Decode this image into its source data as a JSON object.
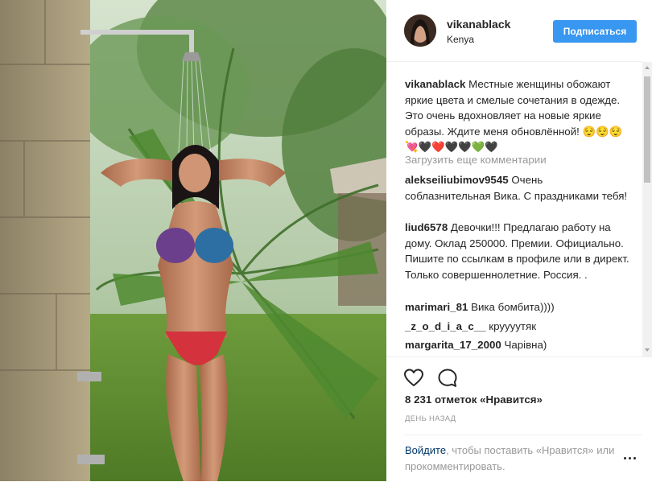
{
  "header": {
    "username": "vikanablack",
    "location": "Kenya",
    "follow_label": "Подписаться"
  },
  "caption": {
    "username": "vikanablack",
    "text": "Местные женщины обожают яркие цвета и смелые сочетания в одежде. Это очень вдохновляет на новые яркие образы. Ждите меня обновлённой!",
    "emoji": "😌😌😌💘🖤❤️🖤🖤💚🖤"
  },
  "load_more_label": "Загрузить еще комментарии",
  "comments": [
    {
      "username": "alekseiliubimov9545",
      "text": "Очень соблазнительная Вика. С праздниками тебя!"
    },
    {
      "username": "liud6578",
      "text": "Девочки!!! Предлагаю работу на дому. Оклад 250000. Премии. Официально. Пишите по ссылкам в профиле или в директ. Только совершеннолетние. Россия. ."
    },
    {
      "username": "marimari_81",
      "text": "Вика бомбита))))"
    },
    {
      "username": "_z_o_d_i_a_c__",
      "text": "круууутяк"
    },
    {
      "username": "margarita_17_2000",
      "text": "Чарівна)"
    }
  ],
  "actions": {
    "like_icon": "heart-outline-icon",
    "comment_icon": "speech-bubble-icon",
    "likes_text": "8 231 отметок «Нравится»",
    "time_text": "ДЕНЬ НАЗАД"
  },
  "login_prompt": {
    "link": "Войдите",
    "text": ", чтобы поставить «Нравится» или прокомментировать."
  },
  "colors": {
    "accent": "#3897f0",
    "link": "#003569",
    "muted": "#999999"
  }
}
